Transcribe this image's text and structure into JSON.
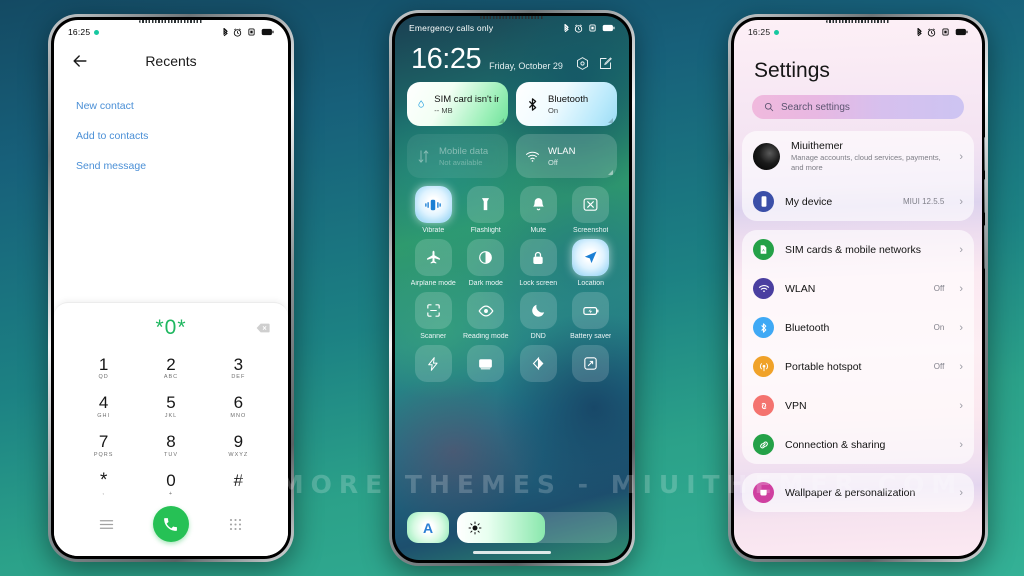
{
  "background": {
    "top_color": "#144a63",
    "bottom_color": "#34b196"
  },
  "watermark": {
    "text": "VISIT FOR MORE THEMES - MIUITHEMER.COM"
  },
  "phone1": {
    "status_bar": {
      "time": "16:25",
      "icons": [
        "bluetooth-icon",
        "alarm-icon",
        "vibrate-icon",
        "battery-icon"
      ]
    },
    "header": {
      "title": "Recents",
      "back_icon": "back-arrow-icon"
    },
    "links": [
      {
        "label": "New contact"
      },
      {
        "label": "Add to contacts"
      },
      {
        "label": "Send message"
      }
    ],
    "dialer": {
      "number": "*0*",
      "number_color": "#1fb760",
      "delete_icon": "backspace-icon",
      "keys": [
        {
          "digit": "1",
          "sub": "QD"
        },
        {
          "digit": "2",
          "sub": "ABC"
        },
        {
          "digit": "3",
          "sub": "DEF"
        },
        {
          "digit": "4",
          "sub": "GHI"
        },
        {
          "digit": "5",
          "sub": "JKL"
        },
        {
          "digit": "6",
          "sub": "MNO"
        },
        {
          "digit": "7",
          "sub": "PQRS"
        },
        {
          "digit": "8",
          "sub": "TUV"
        },
        {
          "digit": "9",
          "sub": "WXYZ"
        },
        {
          "digit": "*",
          "sub": ","
        },
        {
          "digit": "0",
          "sub": "+"
        },
        {
          "digit": "#",
          "sub": ""
        }
      ],
      "actions": {
        "menu_icon": "menu-icon",
        "call_icon": "call-icon",
        "keypad_icon": "keypad-icon",
        "call_color": "#26c155"
      }
    }
  },
  "phone2": {
    "status_bar": {
      "carrier": "Emergency calls only",
      "icons": [
        "bluetooth-icon",
        "alarm-icon",
        "vibrate-icon",
        "battery-icon"
      ]
    },
    "clock": {
      "time": "16:25",
      "date": "Friday, October 29"
    },
    "header_icons": [
      {
        "name": "settings-hex-icon"
      },
      {
        "name": "edit-icon"
      }
    ],
    "big_tiles": [
      {
        "title": "SIM card isn't installed",
        "sub": "-- MB",
        "icon": "data-drop-icon",
        "state": "on"
      },
      {
        "title": "Bluetooth",
        "sub": "On",
        "icon": "bluetooth-icon",
        "state": "bt-on"
      },
      {
        "title": "Mobile data",
        "sub": "Not available",
        "icon": "data-arrows-icon",
        "state": "dim"
      },
      {
        "title": "WLAN",
        "sub": "Off",
        "icon": "wifi-icon",
        "state": "off"
      }
    ],
    "toggles": [
      {
        "label": "Vibrate",
        "icon": "vibrate-icon",
        "active": true
      },
      {
        "label": "Flashlight",
        "icon": "flashlight-icon",
        "active": false
      },
      {
        "label": "Mute",
        "icon": "bell-icon",
        "active": false
      },
      {
        "label": "Screenshot",
        "icon": "screenshot-icon",
        "active": false
      },
      {
        "label": "Airplane mode",
        "icon": "airplane-icon",
        "active": false
      },
      {
        "label": "Dark mode",
        "icon": "contrast-icon",
        "active": false
      },
      {
        "label": "Lock screen",
        "icon": "lock-icon",
        "active": false
      },
      {
        "label": "Location",
        "icon": "location-arrow-icon",
        "active": true
      },
      {
        "label": "Scanner",
        "icon": "scanner-icon",
        "active": false
      },
      {
        "label": "Reading mode",
        "icon": "eye-icon",
        "active": false
      },
      {
        "label": "DND",
        "icon": "moon-icon",
        "active": false
      },
      {
        "label": "Battery saver",
        "icon": "battery-saver-icon",
        "active": false
      },
      {
        "label": "",
        "icon": "lightning-icon",
        "active": false
      },
      {
        "label": "",
        "icon": "cast-icon",
        "active": false
      },
      {
        "label": "",
        "icon": "sync-icon",
        "active": false
      },
      {
        "label": "",
        "icon": "expand-icon",
        "active": false
      }
    ],
    "brightness": {
      "auto_label": "A",
      "auto_color": "#2a7fd4",
      "level_percent": 55,
      "icon": "sun-icon"
    }
  },
  "phone3": {
    "status_bar": {
      "time": "16:25",
      "icons": [
        "bluetooth-icon",
        "alarm-icon",
        "vibrate-icon",
        "battery-icon"
      ]
    },
    "title": "Settings",
    "search": {
      "placeholder": "Search settings",
      "icon": "search-icon"
    },
    "account_card": [
      {
        "title": "Miuithemer",
        "sub": "Manage accounts, cloud services, payments, and more",
        "value": "",
        "icon": "avatar",
        "color": "#1a1a1a"
      },
      {
        "title": "My device",
        "sub": "",
        "value": "MIUI 12.5.5",
        "icon": "device-icon",
        "color": "#3b4fa8"
      }
    ],
    "network_card": [
      {
        "title": "SIM cards & mobile networks",
        "value": "",
        "icon": "sim-icon",
        "color": "#24a148"
      },
      {
        "title": "WLAN",
        "value": "Off",
        "icon": "wifi-icon",
        "color": "#4a3fa0"
      },
      {
        "title": "Bluetooth",
        "value": "On",
        "icon": "bluetooth-icon",
        "color": "#3fa9f5"
      },
      {
        "title": "Portable hotspot",
        "value": "Off",
        "icon": "hotspot-icon",
        "color": "#f0a229"
      },
      {
        "title": "VPN",
        "value": "",
        "icon": "vpn-icon",
        "color": "#f4736f"
      },
      {
        "title": "Connection & sharing",
        "value": "",
        "icon": "link-icon",
        "color": "#24a148"
      }
    ],
    "personal_card": [
      {
        "title": "Wallpaper & personalization",
        "value": "",
        "icon": "wallpaper-icon",
        "color": "#cf3fa0"
      }
    ]
  }
}
